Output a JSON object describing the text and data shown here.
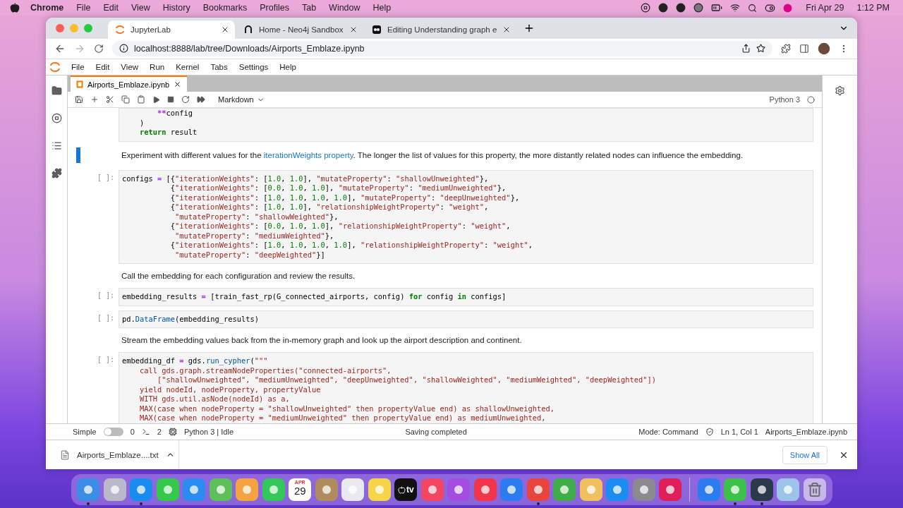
{
  "mac_menu_bar": {
    "app_name": "Chrome",
    "menus": [
      "File",
      "Edit",
      "View",
      "History",
      "Bookmarks",
      "Profiles",
      "Tab",
      "Window",
      "Help"
    ],
    "date": "Fri Apr 29",
    "time": "1:12 PM"
  },
  "browser": {
    "tabs": [
      {
        "title": "JupyterLab",
        "kind": "jupyter",
        "selected": true
      },
      {
        "title": "Home - Neo4j Sandbox",
        "kind": "neo4j",
        "selected": false
      },
      {
        "title": "Editing Understanding graph e",
        "kind": "editor",
        "selected": false
      }
    ],
    "url": "localhost:8888/lab/tree/Downloads/Airports_Emblaze.ipynb",
    "forward_disabled": true
  },
  "jupyter": {
    "menus": [
      "File",
      "Edit",
      "View",
      "Run",
      "Kernel",
      "Tabs",
      "Settings",
      "Help"
    ],
    "document_tab": {
      "title": "Airports_Emblaze.ipynb",
      "selected": true
    },
    "cell_type": "Markdown",
    "kernel_name": "Python 3",
    "kernel_busy": false,
    "cells": [
      {
        "kind": "code",
        "selected": false,
        "lines": [
          [
            {
              "kind": "operator",
              "text": "        **"
            },
            {
              "kind": "plain",
              "text": "config"
            }
          ],
          [
            {
              "kind": "plain",
              "text": "    )"
            }
          ],
          [
            {
              "kind": "keyword",
              "text": "    return"
            },
            {
              "kind": "plain",
              "text": " result"
            }
          ]
        ]
      },
      {
        "kind": "markdown",
        "selected": true,
        "segments": [
          {
            "kind": "plain",
            "text": "Experiment with different values for the "
          },
          {
            "kind": "link",
            "text": "iterationWeights property"
          },
          {
            "kind": "plain",
            "text": ". The longer the list of values for this property, the more distantly related nodes can influence the embedding."
          }
        ]
      },
      {
        "kind": "code",
        "selected": false,
        "prompt": "[ ]:",
        "lines": [
          [
            {
              "kind": "plain",
              "text": "configs "
            },
            {
              "kind": "operator",
              "text": "="
            },
            {
              "kind": "plain",
              "text": " [{"
            },
            {
              "kind": "string",
              "text": "\"iterationWeights\""
            },
            {
              "kind": "plain",
              "text": ": ["
            },
            {
              "kind": "number",
              "text": "1.0"
            },
            {
              "kind": "plain",
              "text": ", "
            },
            {
              "kind": "number",
              "text": "1.0"
            },
            {
              "kind": "plain",
              "text": "], "
            },
            {
              "kind": "string",
              "text": "\"mutateProperty\""
            },
            {
              "kind": "plain",
              "text": ": "
            },
            {
              "kind": "string",
              "text": "\"shallowUnweighted\""
            },
            {
              "kind": "plain",
              "text": "},"
            }
          ],
          [
            {
              "kind": "plain",
              "text": "           {"
            },
            {
              "kind": "string",
              "text": "\"iterationWeights\""
            },
            {
              "kind": "plain",
              "text": ": ["
            },
            {
              "kind": "number",
              "text": "0.0"
            },
            {
              "kind": "plain",
              "text": ", "
            },
            {
              "kind": "number",
              "text": "1.0"
            },
            {
              "kind": "plain",
              "text": ", "
            },
            {
              "kind": "number",
              "text": "1.0"
            },
            {
              "kind": "plain",
              "text": "], "
            },
            {
              "kind": "string",
              "text": "\"mutateProperty\""
            },
            {
              "kind": "plain",
              "text": ": "
            },
            {
              "kind": "string",
              "text": "\"mediumUnweighted\""
            },
            {
              "kind": "plain",
              "text": "},"
            }
          ],
          [
            {
              "kind": "plain",
              "text": "           {"
            },
            {
              "kind": "string",
              "text": "\"iterationWeights\""
            },
            {
              "kind": "plain",
              "text": ": ["
            },
            {
              "kind": "number",
              "text": "1.0"
            },
            {
              "kind": "plain",
              "text": ", "
            },
            {
              "kind": "number",
              "text": "1.0"
            },
            {
              "kind": "plain",
              "text": ", "
            },
            {
              "kind": "number",
              "text": "1.0"
            },
            {
              "kind": "plain",
              "text": ", "
            },
            {
              "kind": "number",
              "text": "1.0"
            },
            {
              "kind": "plain",
              "text": "], "
            },
            {
              "kind": "string",
              "text": "\"mutateProperty\""
            },
            {
              "kind": "plain",
              "text": ": "
            },
            {
              "kind": "string",
              "text": "\"deepUnweighted\""
            },
            {
              "kind": "plain",
              "text": "},"
            }
          ],
          [
            {
              "kind": "plain",
              "text": "           {"
            },
            {
              "kind": "string",
              "text": "\"iterationWeights\""
            },
            {
              "kind": "plain",
              "text": ": ["
            },
            {
              "kind": "number",
              "text": "1.0"
            },
            {
              "kind": "plain",
              "text": ", "
            },
            {
              "kind": "number",
              "text": "1.0"
            },
            {
              "kind": "plain",
              "text": "], "
            },
            {
              "kind": "string",
              "text": "\"relationshipWeightProperty\""
            },
            {
              "kind": "plain",
              "text": ": "
            },
            {
              "kind": "string",
              "text": "\"weight\""
            },
            {
              "kind": "plain",
              "text": ","
            }
          ],
          [
            {
              "kind": "string",
              "text": "            \"mutateProperty\""
            },
            {
              "kind": "plain",
              "text": ": "
            },
            {
              "kind": "string",
              "text": "\"shallowWeighted\""
            },
            {
              "kind": "plain",
              "text": "},"
            }
          ],
          [
            {
              "kind": "plain",
              "text": "           {"
            },
            {
              "kind": "string",
              "text": "\"iterationWeights\""
            },
            {
              "kind": "plain",
              "text": ": ["
            },
            {
              "kind": "number",
              "text": "0.0"
            },
            {
              "kind": "plain",
              "text": ", "
            },
            {
              "kind": "number",
              "text": "1.0"
            },
            {
              "kind": "plain",
              "text": ", "
            },
            {
              "kind": "number",
              "text": "1.0"
            },
            {
              "kind": "plain",
              "text": "], "
            },
            {
              "kind": "string",
              "text": "\"relationshipWeightProperty\""
            },
            {
              "kind": "plain",
              "text": ": "
            },
            {
              "kind": "string",
              "text": "\"weight\""
            },
            {
              "kind": "plain",
              "text": ","
            }
          ],
          [
            {
              "kind": "string",
              "text": "            \"mutateProperty\""
            },
            {
              "kind": "plain",
              "text": ": "
            },
            {
              "kind": "string",
              "text": "\"mediumWeighted\""
            },
            {
              "kind": "plain",
              "text": "},"
            }
          ],
          [
            {
              "kind": "plain",
              "text": "           {"
            },
            {
              "kind": "string",
              "text": "\"iterationWeights\""
            },
            {
              "kind": "plain",
              "text": ": ["
            },
            {
              "kind": "number",
              "text": "1.0"
            },
            {
              "kind": "plain",
              "text": ", "
            },
            {
              "kind": "number",
              "text": "1.0"
            },
            {
              "kind": "plain",
              "text": ", "
            },
            {
              "kind": "number",
              "text": "1.0"
            },
            {
              "kind": "plain",
              "text": ", "
            },
            {
              "kind": "number",
              "text": "1.0"
            },
            {
              "kind": "plain",
              "text": "], "
            },
            {
              "kind": "string",
              "text": "\"relationshipWeightProperty\""
            },
            {
              "kind": "plain",
              "text": ": "
            },
            {
              "kind": "string",
              "text": "\"weight\""
            },
            {
              "kind": "plain",
              "text": ","
            }
          ],
          [
            {
              "kind": "string",
              "text": "            \"mutateProperty\""
            },
            {
              "kind": "plain",
              "text": ": "
            },
            {
              "kind": "string",
              "text": "\"deepWeighted\""
            },
            {
              "kind": "plain",
              "text": "}]"
            }
          ]
        ]
      },
      {
        "kind": "markdown",
        "selected": false,
        "segments": [
          {
            "kind": "plain",
            "text": "Call the embedding for each configuration and review the results."
          }
        ]
      },
      {
        "kind": "code",
        "selected": false,
        "prompt": "[ ]:",
        "lines": [
          [
            {
              "kind": "plain",
              "text": "embedding_results "
            },
            {
              "kind": "operator",
              "text": "="
            },
            {
              "kind": "plain",
              "text": " [train_fast_rp(G_connected_airports, config) "
            },
            {
              "kind": "keyword",
              "text": "for"
            },
            {
              "kind": "plain",
              "text": " config "
            },
            {
              "kind": "keyword",
              "text": "in"
            },
            {
              "kind": "plain",
              "text": " configs]"
            }
          ]
        ]
      },
      {
        "kind": "code",
        "selected": false,
        "prompt": "[ ]:",
        "lines": [
          [
            {
              "kind": "plain",
              "text": "pd."
            },
            {
              "kind": "function",
              "text": "DataFrame"
            },
            {
              "kind": "plain",
              "text": "(embedding_results)"
            }
          ]
        ]
      },
      {
        "kind": "markdown",
        "selected": false,
        "segments": [
          {
            "kind": "plain",
            "text": "Stream the embedding values back from the in-memory graph and look up the airport description and continent."
          }
        ]
      },
      {
        "kind": "code",
        "selected": false,
        "prompt": "[ ]:",
        "lines": [
          [
            {
              "kind": "plain",
              "text": "embedding_df "
            },
            {
              "kind": "operator",
              "text": "="
            },
            {
              "kind": "plain",
              "text": " gds."
            },
            {
              "kind": "function",
              "text": "run_cypher"
            },
            {
              "kind": "plain",
              "text": "("
            },
            {
              "kind": "string",
              "text": "\"\"\""
            }
          ],
          [
            {
              "kind": "string",
              "text": "    call gds.graph.streamNodeProperties(\"connected-airports\","
            }
          ],
          [
            {
              "kind": "string",
              "text": "        [\"shallowUnweighted\", \"mediumUnweighted\", \"deepUnweighted\", \"shallowWeighted\", \"mediumWeighted\", \"deepWeighted\"])"
            }
          ],
          [
            {
              "kind": "string",
              "text": "    yield nodeId, nodeProperty, propertyValue"
            }
          ],
          [
            {
              "kind": "string",
              "text": "    WITH gds.util.asNode(nodeId) as a,"
            }
          ],
          [
            {
              "kind": "string",
              "text": "    MAX(case when nodeProperty = \"shallowUnweighted\" then propertyValue end) as shallowUnweighted,"
            }
          ],
          [
            {
              "kind": "string",
              "text": "    MAX(case when nodeProperty = \"mediumUnweighted\" then propertyValue end) as mediumUnweighted,"
            }
          ]
        ]
      }
    ],
    "status_bar": {
      "mode_label": "Simple",
      "simple_on": false,
      "terminals": "0",
      "kernels": "2",
      "kernel_status": "Python 3 | Idle",
      "message": "Saving completed",
      "mode": "Mode: Command",
      "position": "Ln 1, Col 1",
      "file": "Airports_Emblaze.ipynb"
    }
  },
  "downloads": {
    "file": "Airports_Emblaze....txt",
    "show_all": "Show All"
  },
  "dock": [
    {
      "kind": "app",
      "color": "#3b8de8",
      "running": true
    },
    {
      "kind": "app",
      "color": "#b9b9c9"
    },
    {
      "kind": "app",
      "color": "#1a8cf0",
      "running": true
    },
    {
      "kind": "app",
      "color": "#36c84a"
    },
    {
      "kind": "app",
      "color": "#2a8cf0"
    },
    {
      "kind": "app",
      "color": "#5fbf5a"
    },
    {
      "kind": "app",
      "color": "#f4a340"
    },
    {
      "kind": "app",
      "color": "#34c759"
    },
    {
      "kind": "calendar",
      "month": "APR",
      "day": "29"
    },
    {
      "kind": "app",
      "color": "#b08b5e"
    },
    {
      "kind": "app",
      "color": "#e9e9ef"
    },
    {
      "kind": "app",
      "color": "#f7d54a"
    },
    {
      "kind": "tv",
      "label": "tv"
    },
    {
      "kind": "app",
      "color": "#f54660"
    },
    {
      "kind": "app",
      "color": "#a34ee0"
    },
    {
      "kind": "app",
      "color": "#f2354a"
    },
    {
      "kind": "app",
      "color": "#2a7cf0"
    },
    {
      "kind": "app",
      "color": "#e8453c",
      "running": true
    },
    {
      "kind": "app",
      "color": "#3fae4a"
    },
    {
      "kind": "app",
      "color": "#f0c060"
    },
    {
      "kind": "app",
      "color": "#1b8cf2"
    },
    {
      "kind": "app",
      "color": "#8a8a8f"
    },
    {
      "kind": "app",
      "color": "#e01e5a"
    },
    {
      "kind": "separator"
    },
    {
      "kind": "app",
      "color": "#2b7cf0"
    },
    {
      "kind": "app",
      "color": "#3cc24a",
      "running": true
    },
    {
      "kind": "app",
      "color": "#2b3a4a",
      "running": true
    },
    {
      "kind": "app",
      "color": "#9cc4e8"
    },
    {
      "kind": "trash"
    }
  ]
}
